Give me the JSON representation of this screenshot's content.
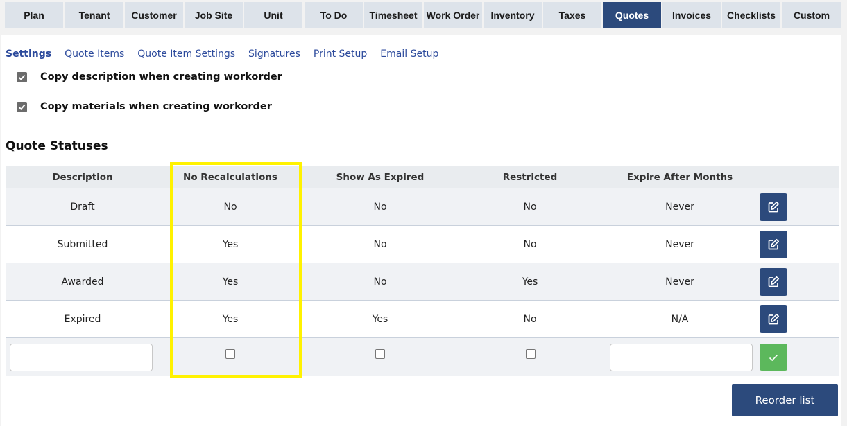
{
  "tabs": [
    "Plan",
    "Tenant",
    "Customer",
    "Job Site",
    "Unit",
    "To Do",
    "Timesheet",
    "Work Order",
    "Inventory",
    "Taxes",
    "Quotes",
    "Invoices",
    "Checklists",
    "Custom"
  ],
  "active_tab": "Quotes",
  "subnav": [
    "Settings",
    "Quote Items",
    "Quote Item Settings",
    "Signatures",
    "Print Setup",
    "Email Setup"
  ],
  "active_subnav": "Settings",
  "options": {
    "copy_description": {
      "label": "Copy description when creating workorder",
      "checked": true
    },
    "copy_materials": {
      "label": "Copy materials when creating workorder",
      "checked": true
    }
  },
  "section_title": "Quote Statuses",
  "table": {
    "headers": {
      "description": "Description",
      "no_recalc": "No Recalculations",
      "show_expired": "Show As Expired",
      "restricted": "Restricted",
      "expire_months": "Expire After Months"
    },
    "rows": [
      {
        "description": "Draft",
        "no_recalc": "No",
        "show_expired": "No",
        "restricted": "No",
        "expire_months": "Never"
      },
      {
        "description": "Submitted",
        "no_recalc": "Yes",
        "show_expired": "No",
        "restricted": "No",
        "expire_months": "Never"
      },
      {
        "description": "Awarded",
        "no_recalc": "Yes",
        "show_expired": "No",
        "restricted": "Yes",
        "expire_months": "Never"
      },
      {
        "description": "Expired",
        "no_recalc": "Yes",
        "show_expired": "Yes",
        "restricted": "No",
        "expire_months": "N/A"
      }
    ],
    "new_row": {
      "description_value": "",
      "expire_months_value": ""
    }
  },
  "reorder_label": "Reorder list",
  "icons": {
    "edit": "edit-icon",
    "save": "check-icon",
    "checkbox": "checkmark-icon"
  },
  "colors": {
    "primary": "#2c4a7c",
    "success": "#5cb85c",
    "highlight": "#fff200",
    "link": "#2c4a9c"
  }
}
